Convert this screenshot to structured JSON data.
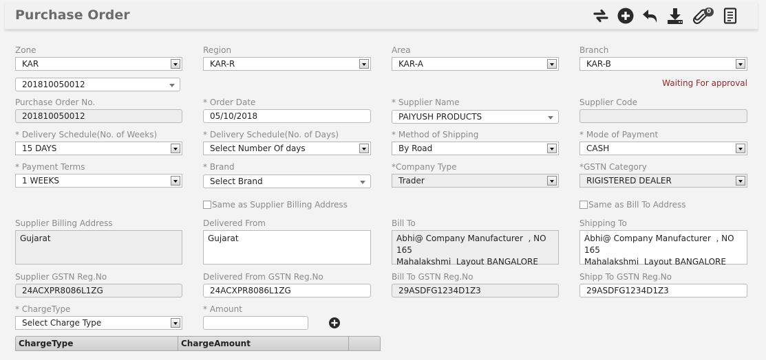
{
  "header": {
    "title": "Purchase Order",
    "toolbar": [
      {
        "icon": "refresh-icon"
      },
      {
        "icon": "add-circle-icon"
      },
      {
        "icon": "back-icon"
      },
      {
        "icon": "download-icon"
      },
      {
        "icon": "attachment-icon",
        "badge": "0"
      },
      {
        "icon": "document-list-icon"
      }
    ]
  },
  "colors": {
    "status": "#8b2a2a",
    "label": "#8a8a8a",
    "title": "#6b6b6b"
  },
  "status": "Waiting For approval",
  "fields": {
    "zone": {
      "label": "Zone",
      "value": "KAR"
    },
    "region": {
      "label": "Region",
      "value": "KAR-R"
    },
    "area": {
      "label": "Area",
      "value": "KAR-A"
    },
    "branch": {
      "label": "Branch",
      "value": "KAR-B"
    },
    "po_select": {
      "value": "201810050012"
    },
    "po_no": {
      "label": "Purchase Order No.",
      "value": "201810050012"
    },
    "order_date": {
      "label": "* Order Date",
      "value": "05/10/2018"
    },
    "supplier_name": {
      "label": "* Supplier Name",
      "value": "PAIYUSH PRODUCTS"
    },
    "supplier_code": {
      "label": "Supplier Code",
      "value": ""
    },
    "delivery_weeks": {
      "label": "* Delivery Schedule(No. of Weeks)",
      "value": "15 DAYS"
    },
    "delivery_days": {
      "label": "* Delivery Schedule(No. of Days)",
      "value": "Select Number Of days"
    },
    "shipping_method": {
      "label": "* Method of Shipping",
      "value": "By Road"
    },
    "payment_mode": {
      "label": "* Mode of Payment",
      "value": "CASH"
    },
    "payment_terms": {
      "label": "* Payment Terms",
      "value": "1 WEEKS"
    },
    "brand": {
      "label": "* Brand",
      "value": "Select Brand"
    },
    "company_type": {
      "label": "*Company Type",
      "value": "Trader"
    },
    "gstn_category": {
      "label": "*GSTN Category",
      "value": "RIGISTERED DEALER"
    },
    "same_as_supplier": {
      "label": "Same as Supplier Billing Address",
      "checked": false
    },
    "same_as_bill_to": {
      "label": "Same as Bill To Address",
      "checked": false
    },
    "supplier_billing_address": {
      "label": "Supplier Billing Address",
      "value": "Gujarat"
    },
    "delivered_from": {
      "label": "Delivered From",
      "value": "Gujarat"
    },
    "bill_to": {
      "label": "Bill To",
      "value": "Abhi@ Company Manufacturer  , NO 165\nMahalakshmi  Layout BANGALORE"
    },
    "shipping_to": {
      "label": "Shipping To",
      "value": "Abhi@ Company Manufacturer  , NO 165\nMahalakshmi  Layout BANGALORE"
    },
    "supplier_gstn": {
      "label": "Supplier GSTN Reg.No",
      "value": "24ACXPR8086L1ZG"
    },
    "delivered_from_gstn": {
      "label": "Delivered From GSTN Reg.No",
      "value": "24ACXPR8086L1ZG"
    },
    "bill_to_gstn": {
      "label": "Bill To GSTN Reg.No",
      "value": "29ASDFG1234D1Z3"
    },
    "ship_to_gstn": {
      "label": "Shipp To GSTN Reg.No",
      "value": "29ASDFG1234D1Z3"
    },
    "charge_type": {
      "label": "* ChargeType",
      "value": "Select Charge Type"
    },
    "amount": {
      "label": "* Amount",
      "value": ""
    }
  },
  "charges_table": {
    "columns": [
      "ChargeType",
      "ChargeAmount",
      ""
    ]
  }
}
